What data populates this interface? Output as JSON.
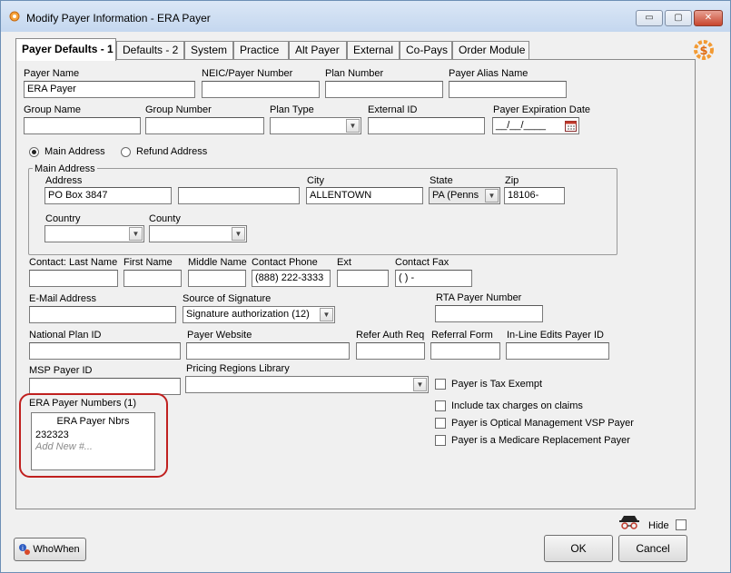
{
  "window": {
    "title": "Modify Payer Information - ERA Payer",
    "minimize": "▭",
    "maximize": "▢",
    "close": "✕"
  },
  "tabs": [
    {
      "label": "Payer Defaults - 1"
    },
    {
      "label": "Defaults - 2"
    },
    {
      "label": "System"
    },
    {
      "label": "Practice"
    },
    {
      "label": "Alt Payer"
    },
    {
      "label": "External"
    },
    {
      "label": "Co-Pays"
    },
    {
      "label": "Order Module"
    }
  ],
  "fields": {
    "payer_name": {
      "label": "Payer Name",
      "value": "ERA Payer"
    },
    "neic": {
      "label": "NEIC/Payer Number",
      "value": ""
    },
    "plan_number": {
      "label": "Plan Number",
      "value": ""
    },
    "payer_alias": {
      "label": "Payer Alias Name",
      "value": ""
    },
    "group_name": {
      "label": "Group Name",
      "value": ""
    },
    "group_number": {
      "label": "Group Number",
      "value": ""
    },
    "plan_type": {
      "label": "Plan Type",
      "value": ""
    },
    "external_id": {
      "label": "External ID",
      "value": ""
    },
    "expiration": {
      "label": "Payer Expiration Date",
      "value": "__/__/____"
    }
  },
  "address_mode": {
    "main": "Main Address",
    "refund": "Refund Address",
    "selected": "main"
  },
  "main_address": {
    "group_title": "Main Address",
    "address_label": "Address",
    "address1": "PO Box 3847",
    "address2": "",
    "city_label": "City",
    "city": "ALLENTOWN",
    "state_label": "State",
    "state": "PA  (Penns",
    "zip_label": "Zip",
    "zip": "18106-",
    "country_label": "Country",
    "country": "",
    "county_label": "County",
    "county": ""
  },
  "contact": {
    "last_label": "Contact:  Last Name",
    "first_label": "First Name",
    "middle_label": "Middle Name",
    "phone_label": "Contact Phone",
    "phone": "(888) 222-3333",
    "ext_label": "Ext",
    "fax_label": "Contact Fax",
    "fax": "(  )    -"
  },
  "email": {
    "label": "E-Mail Address",
    "value": ""
  },
  "signature": {
    "label": "Source of Signature",
    "value": "Signature authorization (12)"
  },
  "rta": {
    "label": "RTA Payer Number",
    "value": ""
  },
  "national_plan": {
    "label": "National Plan ID",
    "value": ""
  },
  "website": {
    "label": "Payer Website",
    "value": ""
  },
  "refer_auth": {
    "label": "Refer Auth Req",
    "value": ""
  },
  "referral_form": {
    "label": "Referral Form",
    "value": ""
  },
  "inline_edits": {
    "label": "In-Line Edits Payer ID",
    "value": ""
  },
  "msp": {
    "label": "MSP Payer ID",
    "value": ""
  },
  "pricing": {
    "label": "Pricing Regions Library",
    "value": ""
  },
  "era": {
    "label": "ERA Payer Numbers (1)",
    "header": "ERA Payer Nbrs",
    "items": [
      "232323"
    ],
    "add_new": "Add New #..."
  },
  "checkboxes": [
    {
      "label": "Payer is Tax Exempt",
      "checked": false
    },
    {
      "label": "Include tax charges on claims",
      "checked": false
    },
    {
      "label": "Payer is Optical Management VSP Payer",
      "checked": false
    },
    {
      "label": "Payer is a Medicare Replacement Payer",
      "checked": false
    }
  ],
  "footer": {
    "whowhen": "WhoWhen",
    "hide": "Hide",
    "ok": "OK",
    "cancel": "Cancel"
  },
  "colors": {
    "highlight": "#c0201f",
    "title_bar": "#c4d7ef"
  }
}
